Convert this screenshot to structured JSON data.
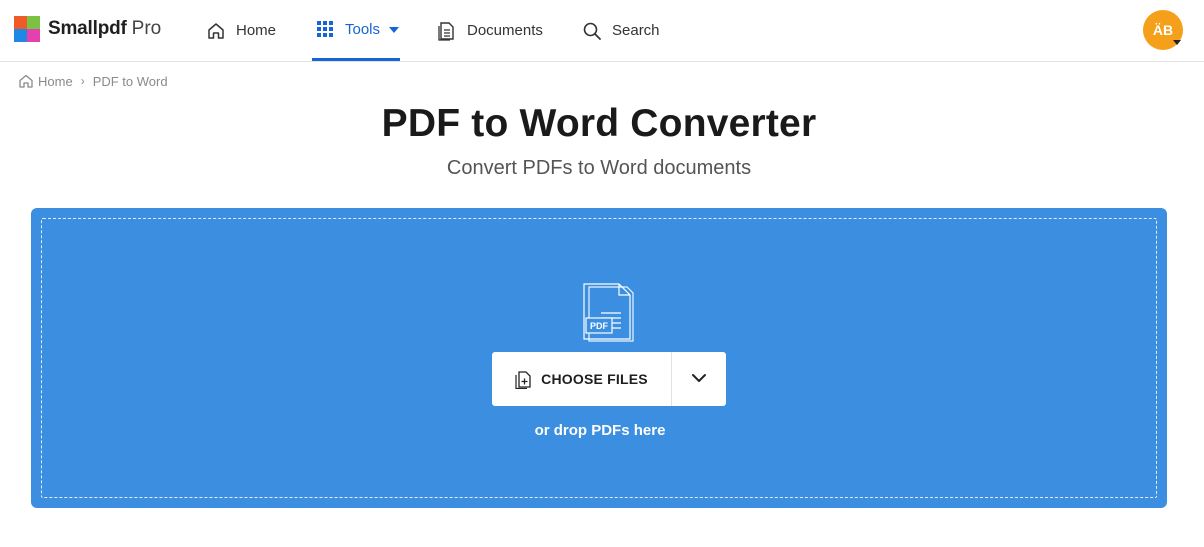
{
  "brand": {
    "name": "Smallpdf",
    "tier": "Pro",
    "logo_colors": [
      "#f05a28",
      "#7cc242",
      "#1e88e5",
      "#e63fae"
    ]
  },
  "nav": {
    "home": {
      "label": "Home",
      "icon": "home-icon"
    },
    "tools": {
      "label": "Tools",
      "icon": "grid-icon",
      "active": true
    },
    "documents": {
      "label": "Documents",
      "icon": "documents-icon"
    },
    "search": {
      "label": "Search",
      "icon": "search-icon"
    }
  },
  "user": {
    "initials": "ÄB",
    "avatar_color": "#f5a01a"
  },
  "breadcrumb": {
    "home": "Home",
    "current": "PDF to Word",
    "separator": "›"
  },
  "page": {
    "title": "PDF to Word Converter",
    "subtitle": "Convert PDFs to Word documents"
  },
  "dropzone": {
    "background": "#3b8ee0",
    "file_badge": "PDF",
    "choose_label": "CHOOSE FILES",
    "hint": "or drop PDFs here"
  },
  "accent_color": "#1565d8"
}
